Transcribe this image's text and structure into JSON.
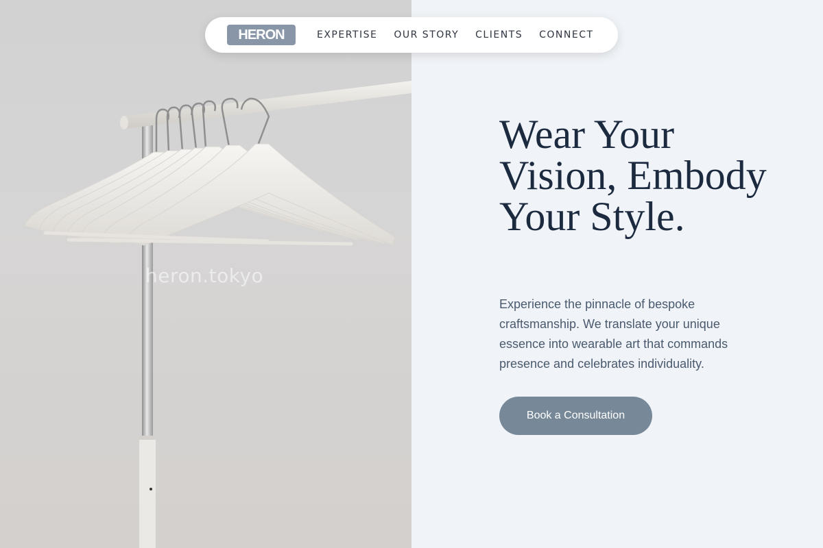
{
  "nav": {
    "logo": "HERON",
    "links": [
      {
        "label": "EXPERTISE"
      },
      {
        "label": "OUR STORY"
      },
      {
        "label": "CLIENTS"
      },
      {
        "label": "CONNECT"
      }
    ]
  },
  "hero": {
    "watermark": "heron.tokyo",
    "headline": "Wear Your Vision, Embody Your Style.",
    "lead": "Experience the pinnacle of bespoke craftsmanship. We translate your unique essence into wearable art that commands presence and celebrates individuality.",
    "cta_label": "Book a Consultation"
  },
  "colors": {
    "accent": "#778899",
    "heading": "#1c2a40",
    "panel_bg": "#f0f3f7"
  }
}
